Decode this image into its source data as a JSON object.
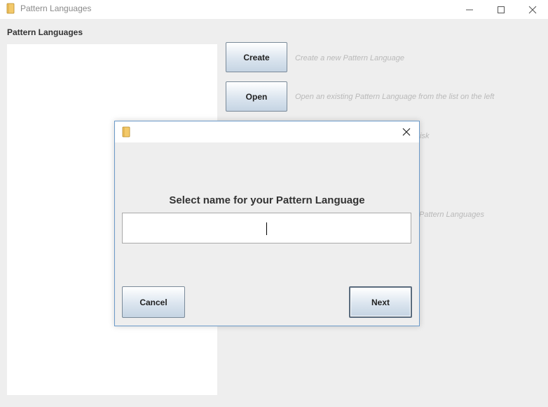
{
  "window": {
    "title": "Pattern Languages",
    "icon": "document-icon"
  },
  "left_panel": {
    "label": "Pattern Languages",
    "items": []
  },
  "actions": [
    {
      "label": "Create",
      "description": "Create a new Pattern Language"
    },
    {
      "label": "Open",
      "description": "Open an existing Pattern Language from the list on the left"
    }
  ],
  "obscured_descriptions": {
    "third_fragment": "isk",
    "fourth_fragment": "Pattern Languages"
  },
  "dialog": {
    "title": "",
    "prompt": "Select name for your Pattern Language",
    "name_value": "",
    "cancel_label": "Cancel",
    "next_label": "Next"
  }
}
